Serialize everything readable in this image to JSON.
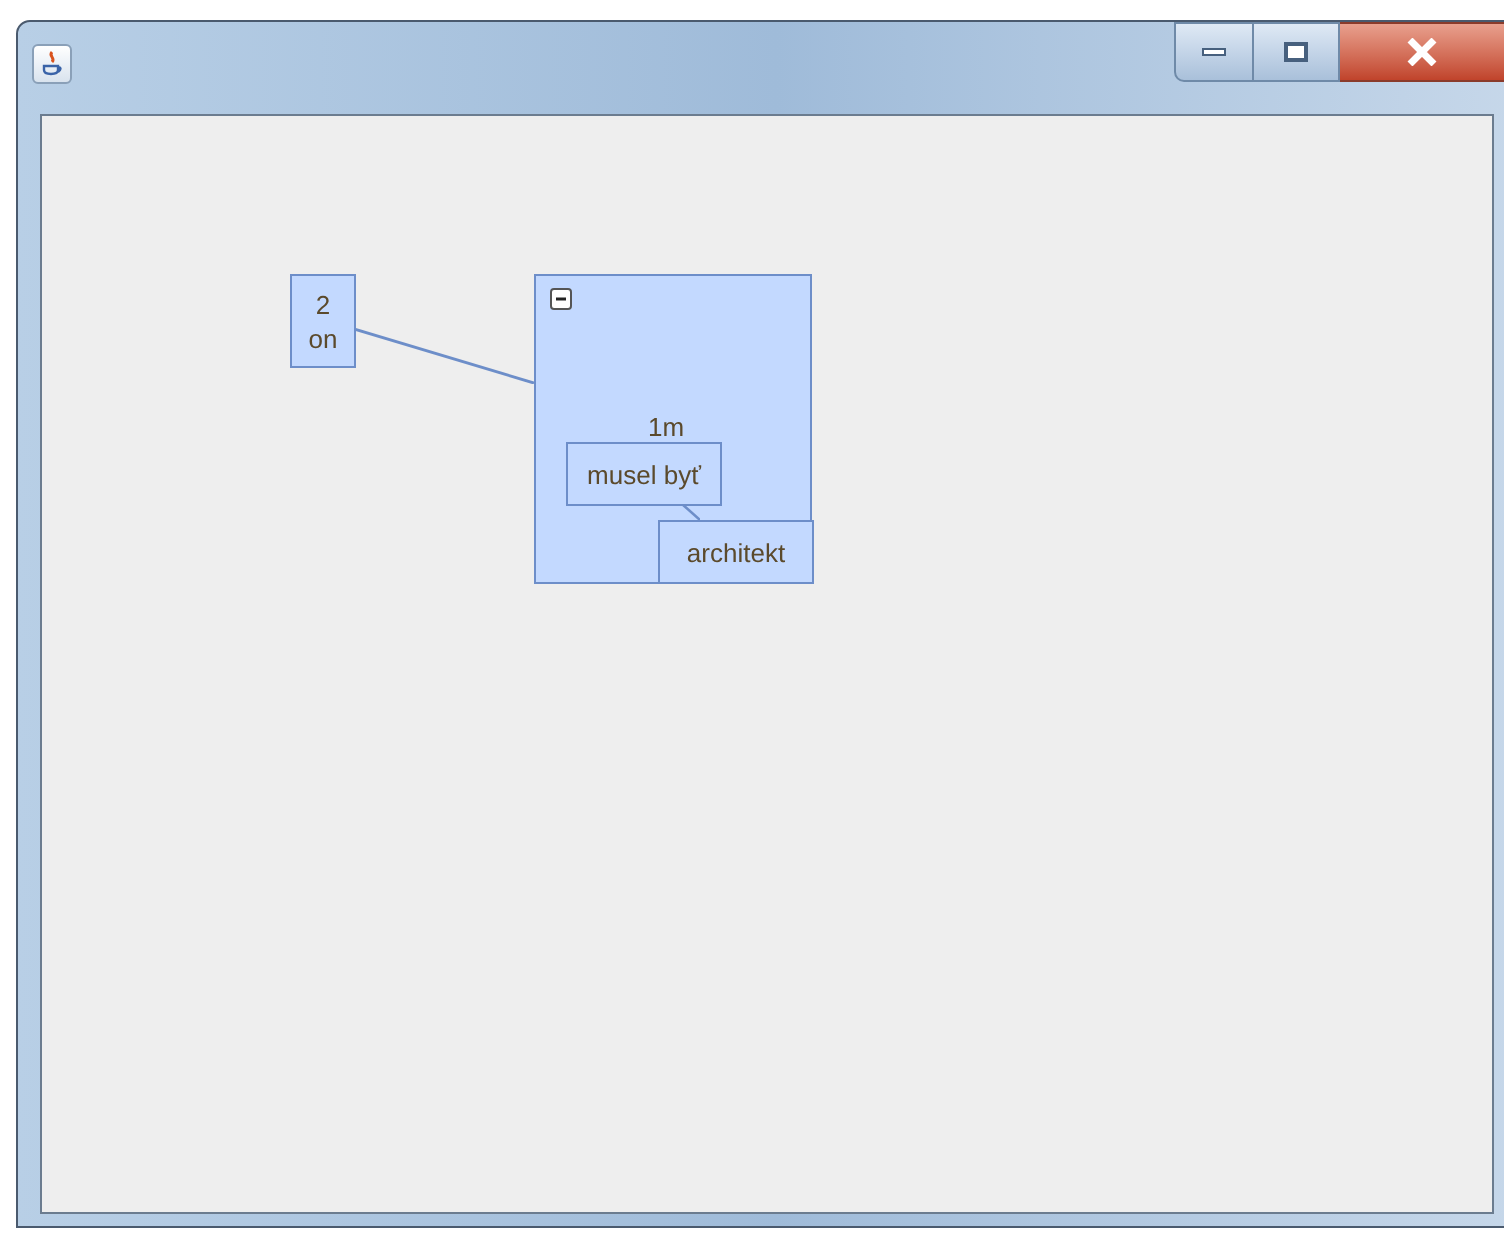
{
  "window": {
    "controls": [
      {
        "kind": "minimize"
      },
      {
        "kind": "maximize"
      },
      {
        "kind": "close"
      }
    ]
  },
  "graph": {
    "nodes": [
      {
        "kind": "vertex",
        "lines": [
          "2",
          "on"
        ]
      },
      {
        "kind": "group",
        "label": "1m",
        "expanded": true,
        "children": [
          {
            "kind": "vertex",
            "lines": [
              "musel byť"
            ]
          },
          {
            "kind": "vertex",
            "lines": [
              "architekt"
            ]
          }
        ]
      }
    ]
  }
}
